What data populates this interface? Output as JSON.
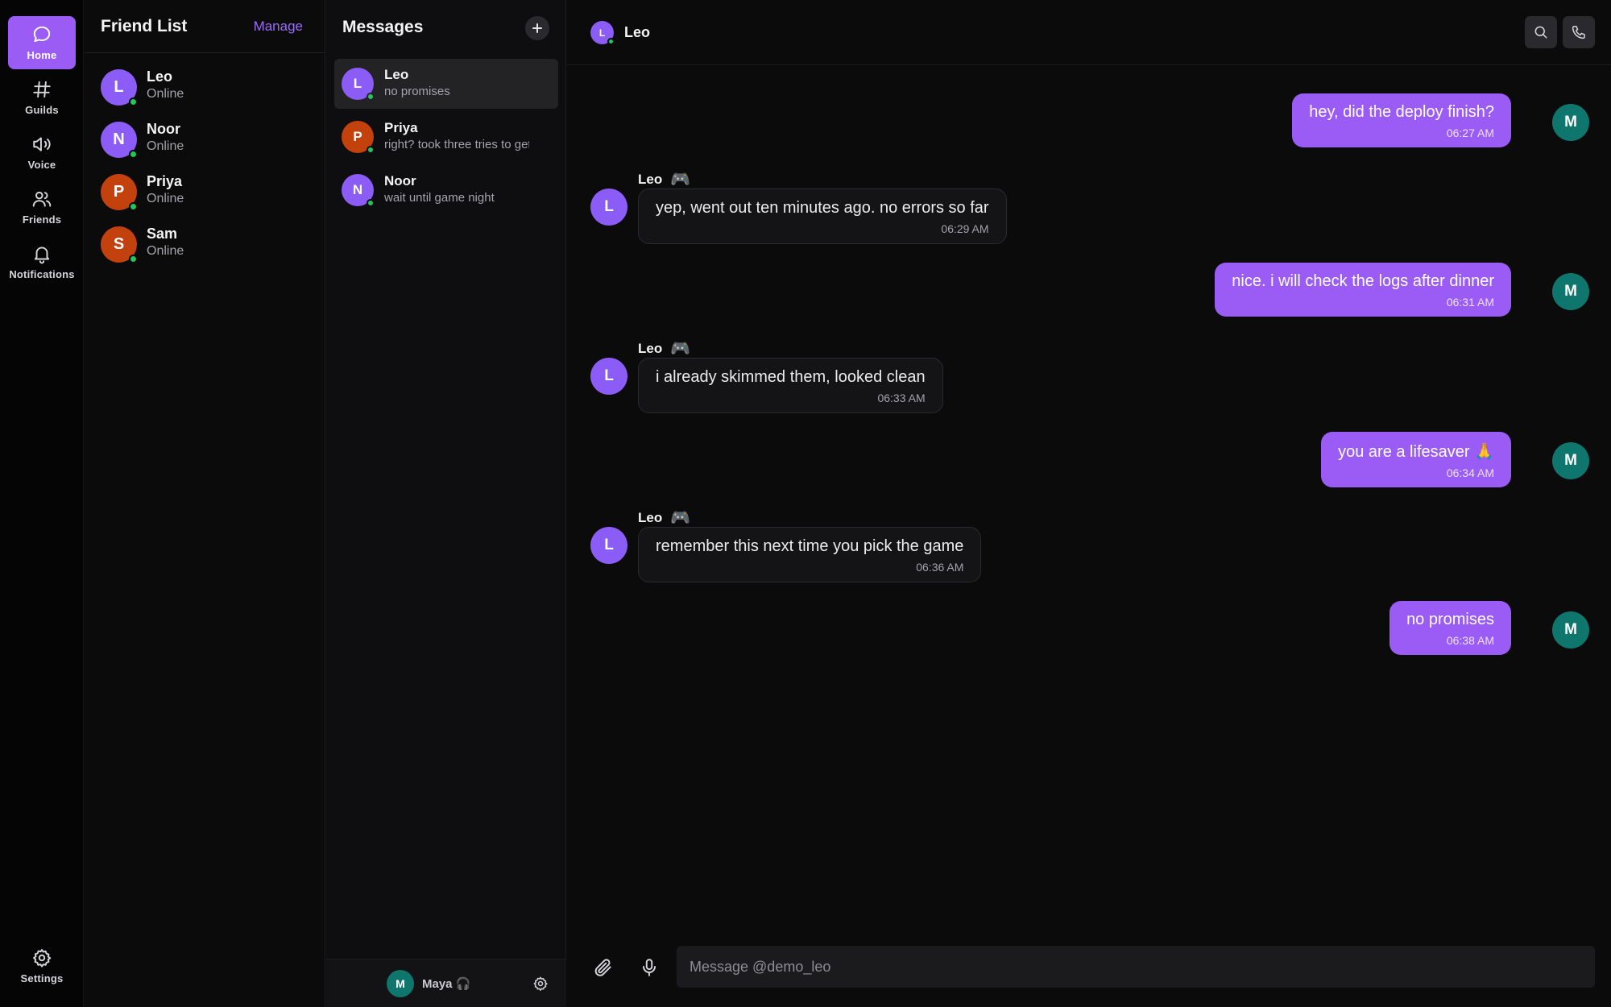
{
  "colors": {
    "accent": "#9b5cf6",
    "online": "#22c55e",
    "avatar_purple": "#8b5cf6",
    "avatar_orange": "#c2410c",
    "avatar_teal": "#0f766e"
  },
  "rail": {
    "items": [
      {
        "label": "Home",
        "icon": "chat-bubble-icon",
        "active": true
      },
      {
        "label": "Guilds",
        "icon": "hash-icon"
      },
      {
        "label": "Voice",
        "icon": "speaker-icon"
      },
      {
        "label": "Friends",
        "icon": "users-icon"
      },
      {
        "label": "Notifications",
        "icon": "bell-icon"
      }
    ],
    "settings_label": "Settings"
  },
  "friends": {
    "title": "Friend List",
    "manage_label": "Manage",
    "items": [
      {
        "initial": "L",
        "name": "Leo",
        "status": "Online"
      },
      {
        "initial": "N",
        "name": "Noor",
        "status": "Online"
      },
      {
        "initial": "P",
        "name": "Priya",
        "status": "Online"
      },
      {
        "initial": "S",
        "name": "Sam",
        "status": "Online"
      }
    ]
  },
  "messages": {
    "title": "Messages",
    "dms": [
      {
        "initial": "L",
        "name": "Leo",
        "preview": "no promises",
        "active": true
      },
      {
        "initial": "P",
        "name": "Priya",
        "preview": "right? took three tries to get it"
      },
      {
        "initial": "N",
        "name": "Noor",
        "preview": "wait until game night"
      }
    ]
  },
  "user": {
    "initial": "M",
    "name": "Maya 🎧"
  },
  "chat": {
    "recipient_initial": "L",
    "recipient_name": "Leo",
    "sender_badge": "🎮",
    "messages": [
      {
        "from": "me",
        "initial": "M",
        "text": "hey, did the deploy finish?",
        "time": "06:27 AM"
      },
      {
        "from": "them",
        "initial": "L",
        "name": "Leo",
        "text": "yep, went out ten minutes ago. no errors so far",
        "time": "06:29 AM"
      },
      {
        "from": "me",
        "initial": "M",
        "text": "nice. i will check the logs after dinner",
        "time": "06:31 AM"
      },
      {
        "from": "them",
        "initial": "L",
        "name": "Leo",
        "text": "i already skimmed them, looked clean",
        "time": "06:33 AM"
      },
      {
        "from": "me",
        "initial": "M",
        "text": "you are a lifesaver 🙏",
        "time": "06:34 AM"
      },
      {
        "from": "them",
        "initial": "L",
        "name": "Leo",
        "text": "remember this next time you pick the game",
        "time": "06:36 AM"
      },
      {
        "from": "me",
        "initial": "M",
        "text": "no promises",
        "time": "06:38 AM"
      }
    ],
    "composer_placeholder": "Message @demo_leo"
  }
}
